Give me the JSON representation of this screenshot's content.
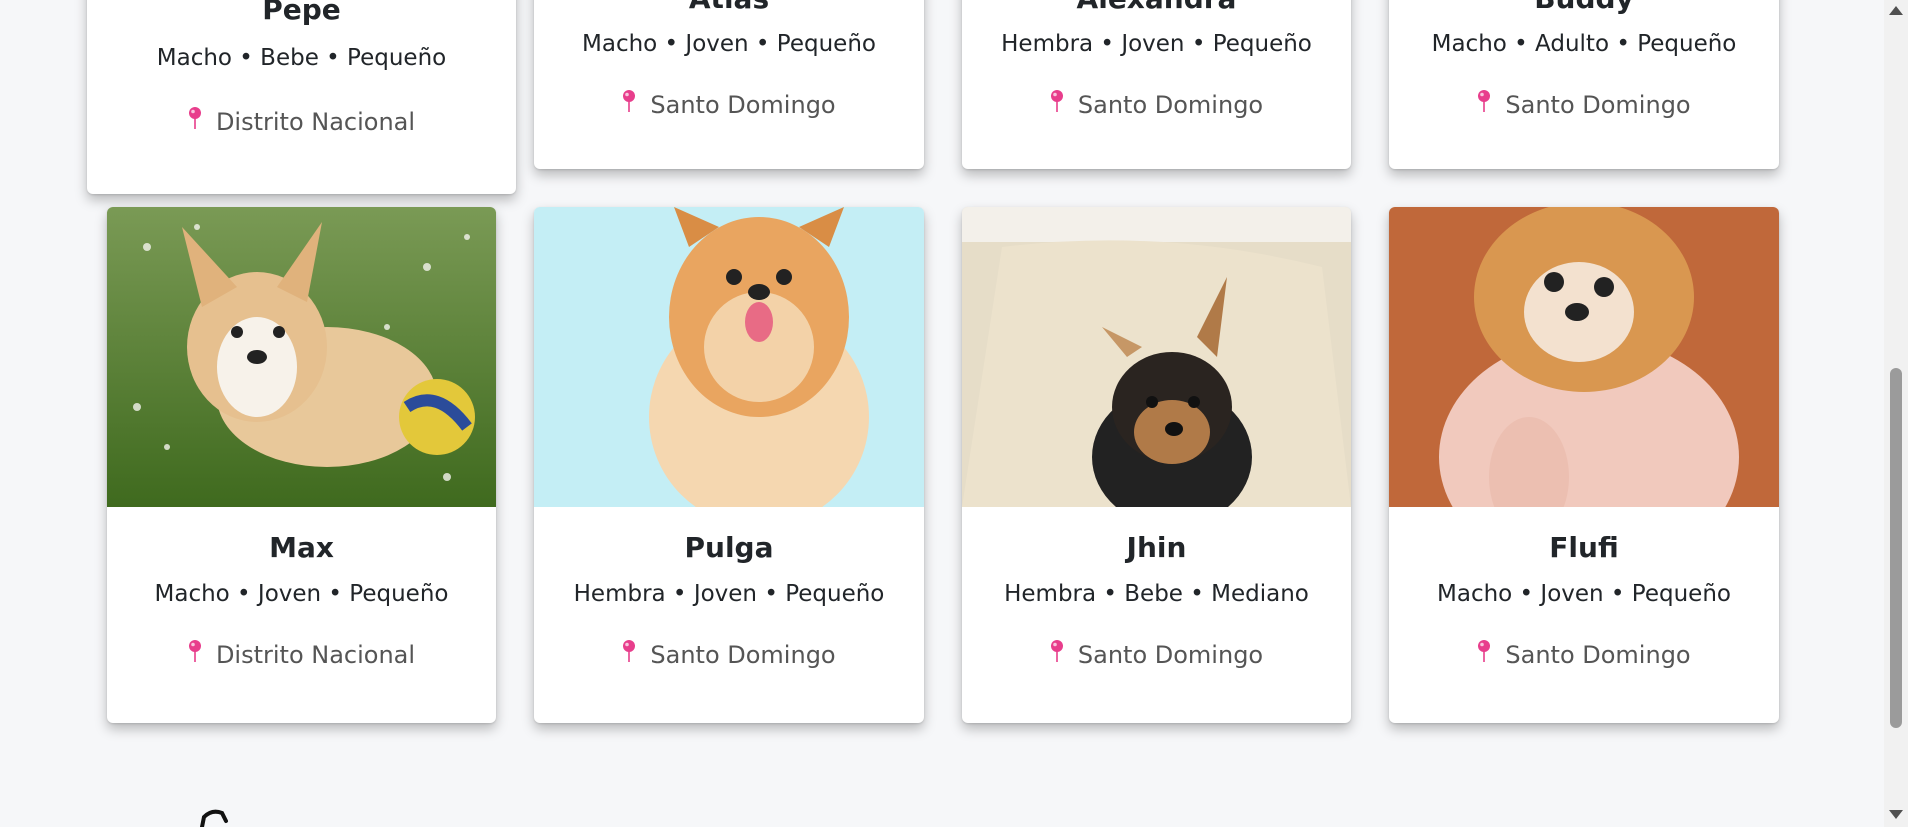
{
  "pets_top": [
    {
      "name": "Pepe",
      "meta": "Macho • Bebe • Pequeño",
      "location": "Distrito Nacional"
    },
    {
      "name": "Atlas",
      "meta": "Macho • Joven • Pequeño",
      "location": "Santo Domingo"
    },
    {
      "name": "Alexandra",
      "meta": "Hembra • Joven • Pequeño",
      "location": "Santo Domingo"
    },
    {
      "name": "Buddy",
      "meta": "Macho • Adulto • Pequeño",
      "location": "Santo Domingo"
    }
  ],
  "pets_bottom": [
    {
      "name": "Max",
      "meta": "Macho • Joven • Pequeño",
      "location": "Distrito Nacional"
    },
    {
      "name": "Pulga",
      "meta": "Hembra • Joven • Pequeño",
      "location": "Santo Domingo"
    },
    {
      "name": "Jhin",
      "meta": "Hembra • Bebe • Mediano",
      "location": "Santo Domingo"
    },
    {
      "name": "Flufi",
      "meta": "Macho • Joven • Pequeño",
      "location": "Santo Domingo"
    }
  ],
  "colors": {
    "pin": "#e83e8c",
    "background": "#f6f7f9"
  },
  "icons": {
    "location": "map-pin-icon"
  }
}
